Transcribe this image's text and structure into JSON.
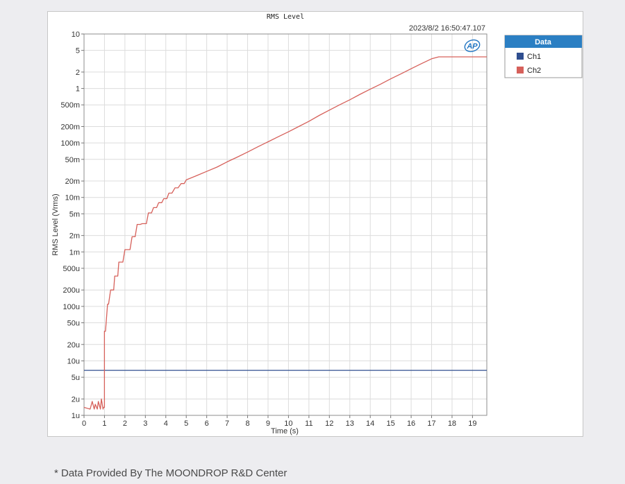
{
  "footnote": "* Data Provided By The MOONDROP R&D Center",
  "colors": {
    "ch1": "#2f4e8f",
    "ch2": "#d6605a",
    "legend_header": "#2b7fc3",
    "grid": "#dcdcdc",
    "ap_logo": "#1f74c2"
  },
  "chart_data": {
    "type": "line",
    "title": "RMS Level",
    "timestamp": "2023/8/2 16:50:47.107",
    "logo_text": "AP",
    "xlabel": "Time (s)",
    "ylabel": "RMS Level (Vrms)",
    "xlim": [
      0,
      19.7
    ],
    "ylim": [
      1e-06,
      10
    ],
    "y_scale": "log",
    "grid": true,
    "x_ticks": [
      0,
      1,
      2,
      3,
      4,
      5,
      6,
      7,
      8,
      9,
      10,
      11,
      12,
      13,
      14,
      15,
      16,
      17,
      18,
      19
    ],
    "x_tick_labels": [
      "0",
      "1",
      "2",
      "3",
      "4",
      "5",
      "6",
      "7",
      "8",
      "9",
      "10",
      "11",
      "12",
      "13",
      "14",
      "15",
      "16",
      "17",
      "18",
      "19"
    ],
    "y_ticks": [
      {
        "value": 10,
        "label": "10"
      },
      {
        "value": 5,
        "label": "5"
      },
      {
        "value": 2,
        "label": "2"
      },
      {
        "value": 1,
        "label": "1"
      },
      {
        "value": 0.5,
        "label": "500m"
      },
      {
        "value": 0.2,
        "label": "200m"
      },
      {
        "value": 0.1,
        "label": "100m"
      },
      {
        "value": 0.05,
        "label": "50m"
      },
      {
        "value": 0.02,
        "label": "20m"
      },
      {
        "value": 0.01,
        "label": "10m"
      },
      {
        "value": 0.005,
        "label": "5m"
      },
      {
        "value": 0.002,
        "label": "2m"
      },
      {
        "value": 0.001,
        "label": "1m"
      },
      {
        "value": 0.0005,
        "label": "500u"
      },
      {
        "value": 0.0002,
        "label": "200u"
      },
      {
        "value": 0.0001,
        "label": "100u"
      },
      {
        "value": 5e-05,
        "label": "50u"
      },
      {
        "value": 2e-05,
        "label": "20u"
      },
      {
        "value": 1e-05,
        "label": "10u"
      },
      {
        "value": 5e-06,
        "label": "5u"
      },
      {
        "value": 2e-06,
        "label": "2u"
      },
      {
        "value": 1e-06,
        "label": "1u"
      }
    ],
    "legend": {
      "title": "Data",
      "placement": "right"
    },
    "series": [
      {
        "name": "Ch1",
        "color": "#2f4e8f",
        "x": [
          0,
          19.7
        ],
        "y": [
          6.7e-06,
          6.7e-06
        ]
      },
      {
        "name": "Ch2",
        "color": "#d6605a",
        "x": [
          0,
          0.3,
          0.4,
          0.5,
          0.55,
          0.65,
          0.7,
          0.8,
          0.85,
          0.93,
          0.95,
          1.0,
          1.0,
          1.05,
          1.15,
          1.2,
          1.3,
          1.45,
          1.5,
          1.65,
          1.7,
          1.9,
          2.0,
          2.25,
          2.35,
          2.5,
          2.6,
          2.75,
          2.85,
          3.05,
          3.15,
          3.3,
          3.4,
          3.55,
          3.65,
          3.8,
          3.9,
          4.05,
          4.15,
          4.3,
          4.45,
          4.6,
          4.75,
          4.9,
          5.0,
          5.5,
          6.0,
          6.5,
          7.0,
          7.5,
          8.0,
          8.5,
          9.0,
          9.5,
          10.0,
          10.5,
          11.0,
          11.5,
          12.0,
          12.5,
          13.0,
          13.5,
          14.0,
          14.5,
          15.0,
          15.5,
          16.0,
          16.5,
          17.0,
          17.35,
          19.7
        ],
        "y": [
          1.4e-06,
          1.3e-06,
          1.8e-06,
          1.3e-06,
          1.6e-06,
          1.3e-06,
          1.8e-06,
          1.3e-06,
          2e-06,
          1.3e-06,
          1.4e-06,
          1.4e-06,
          3.5e-05,
          3.5e-05,
          0.00011,
          0.00011,
          0.0002,
          0.0002,
          0.00036,
          0.00036,
          0.00065,
          0.00065,
          0.0011,
          0.0011,
          0.0019,
          0.0019,
          0.0032,
          0.0032,
          0.0033,
          0.0033,
          0.0052,
          0.0052,
          0.0065,
          0.0065,
          0.008,
          0.008,
          0.0095,
          0.0095,
          0.012,
          0.012,
          0.015,
          0.015,
          0.018,
          0.018,
          0.021,
          0.025,
          0.03,
          0.036,
          0.045,
          0.055,
          0.068,
          0.085,
          0.105,
          0.13,
          0.16,
          0.2,
          0.25,
          0.32,
          0.4,
          0.5,
          0.62,
          0.78,
          0.97,
          1.2,
          1.5,
          1.85,
          2.3,
          2.85,
          3.5,
          3.8,
          3.8
        ]
      }
    ]
  }
}
